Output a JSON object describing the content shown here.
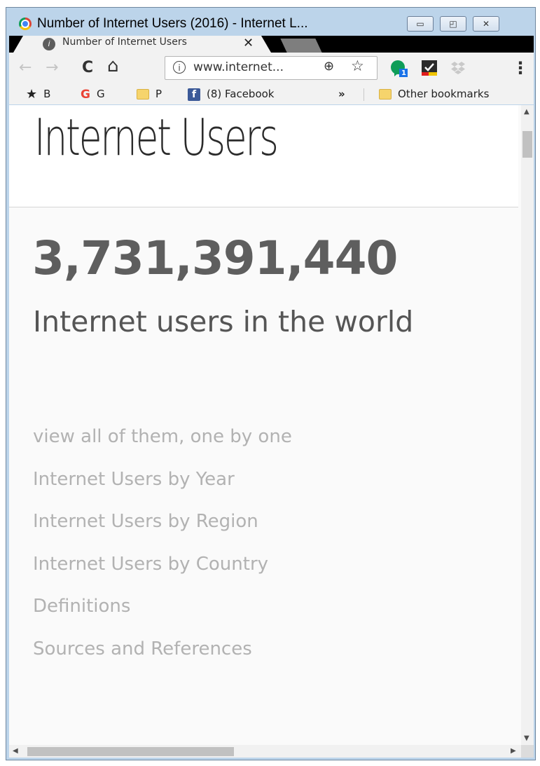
{
  "window": {
    "title": "Number of Internet Users (2016) - Internet L...",
    "controls": {
      "minimize": "▭",
      "maximize": "◰",
      "close": "✕"
    }
  },
  "tab": {
    "favicon_glyph": "i",
    "title": "Number of Internet Users",
    "close": "✕"
  },
  "toolbar": {
    "back": "←",
    "forward": "→",
    "reload": "C",
    "home": "⌂",
    "info": "i",
    "url": "www.internet...",
    "zoom": "⊕",
    "star": "☆",
    "hangouts_badge": "1",
    "menu": "⋮"
  },
  "bookmarks": {
    "items": [
      {
        "icon": "star-icon",
        "label": "B"
      },
      {
        "icon": "google-icon",
        "label": "G"
      },
      {
        "icon": "folder-icon",
        "label": "P"
      },
      {
        "icon": "facebook-icon",
        "label": "(8) Facebook"
      }
    ],
    "overflow": "»",
    "other": "Other bookmarks"
  },
  "page": {
    "heading": "Internet Users",
    "counter": "3,731,391,440",
    "caption": "Internet users in the world",
    "links": [
      "view all of them, one by one",
      "Internet Users by Year",
      "Internet Users by Region",
      "Internet Users by Country",
      "Definitions",
      "Sources and References"
    ]
  },
  "colors": {
    "window_frame": "#bcd4ea",
    "toolbar_bg": "#f2f2f2",
    "page_bg": "#fafafa",
    "counter_text": "#5e5e5e",
    "link_text": "#b2b2b2"
  }
}
